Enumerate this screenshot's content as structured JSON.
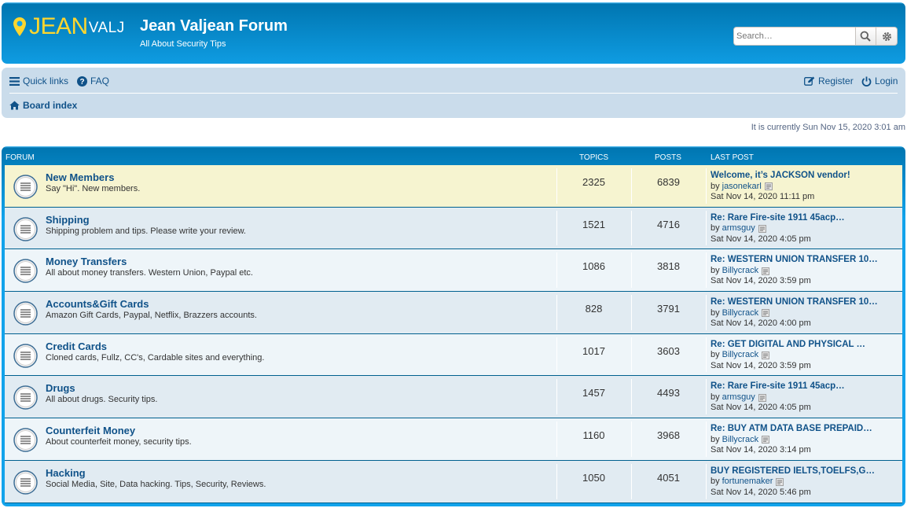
{
  "header": {
    "logo_jean": "JEAN",
    "logo_valj": "VALJ",
    "site_title": "Jean Valjean Forum",
    "site_description": "All About Security Tips",
    "search_placeholder": "Search…",
    "search_icon": "search-icon",
    "advanced_search_icon": "gear-icon"
  },
  "nav": {
    "quick_links": "Quick links",
    "faq": "FAQ",
    "register": "Register",
    "login": "Login",
    "board_index": "Board index"
  },
  "current_time": "It is currently Sun Nov 15, 2020 3:01 am",
  "table": {
    "col_forum": "FORUM",
    "col_topics": "TOPICS",
    "col_posts": "POSTS",
    "col_last_post": "LAST POST"
  },
  "forums": [
    {
      "name": "New Members",
      "desc": "Say \"Hi\". New members.",
      "topics": "2325",
      "posts": "6839",
      "last_title": "Welcome, it’s JACKSON vendor!",
      "by": "by",
      "user": "jasonekarl",
      "date": "Sat Nov 14, 2020 11:11 pm"
    },
    {
      "name": "Shipping",
      "desc": "Shipping problem and tips. Please write your review.",
      "topics": "1521",
      "posts": "4716",
      "last_title": "Re: Rare Fire-site 1911 45acp…",
      "by": "by",
      "user": "armsguy",
      "date": "Sat Nov 14, 2020 4:05 pm"
    },
    {
      "name": "Money Transfers",
      "desc": "All about money transfers. Western Union, Paypal etc.",
      "topics": "1086",
      "posts": "3818",
      "last_title": "Re: WESTERN UNION TRANSFER 10…",
      "by": "by",
      "user": "Billycrack",
      "date": "Sat Nov 14, 2020 3:59 pm"
    },
    {
      "name": "Accounts&Gift Cards",
      "desc": "Amazon Gift Cards, Paypal, Netflix, Brazzers accounts.",
      "topics": "828",
      "posts": "3791",
      "last_title": "Re: WESTERN UNION TRANSFER 10…",
      "by": "by",
      "user": "Billycrack",
      "date": "Sat Nov 14, 2020 4:00 pm"
    },
    {
      "name": "Credit Cards",
      "desc": "Cloned cards, Fullz, CC's, Cardable sites and everything.",
      "topics": "1017",
      "posts": "3603",
      "last_title": "Re: GET DIGITAL AND PHYSICAL …",
      "by": "by",
      "user": "Billycrack",
      "date": "Sat Nov 14, 2020 3:59 pm"
    },
    {
      "name": "Drugs",
      "desc": "All about drugs. Security tips.",
      "topics": "1457",
      "posts": "4493",
      "last_title": "Re: Rare Fire-site 1911 45acp…",
      "by": "by",
      "user": "armsguy",
      "date": "Sat Nov 14, 2020 4:05 pm"
    },
    {
      "name": "Counterfeit Money",
      "desc": "About counterfeit money, security tips.",
      "topics": "1160",
      "posts": "3968",
      "last_title": "Re: BUY ATM DATA BASE PREPAID…",
      "by": "by",
      "user": "Billycrack",
      "date": "Sat Nov 14, 2020 3:14 pm"
    },
    {
      "name": "Hacking",
      "desc": "Social Media, Site, Data hacking. Tips, Security, Reviews.",
      "topics": "1050",
      "posts": "4051",
      "last_title": "BUY REGISTERED IELTS,TOELFS,G…",
      "by": "by",
      "user": "fortunemaker",
      "date": "Sat Nov 14, 2020 5:46 pm"
    }
  ],
  "colors": {
    "header_blue": "#12a3eb",
    "nav_bg": "#cadceb",
    "link": "#105289",
    "logo_yellow": "#ffd62e",
    "row_highlight": "#f6f4d0"
  }
}
